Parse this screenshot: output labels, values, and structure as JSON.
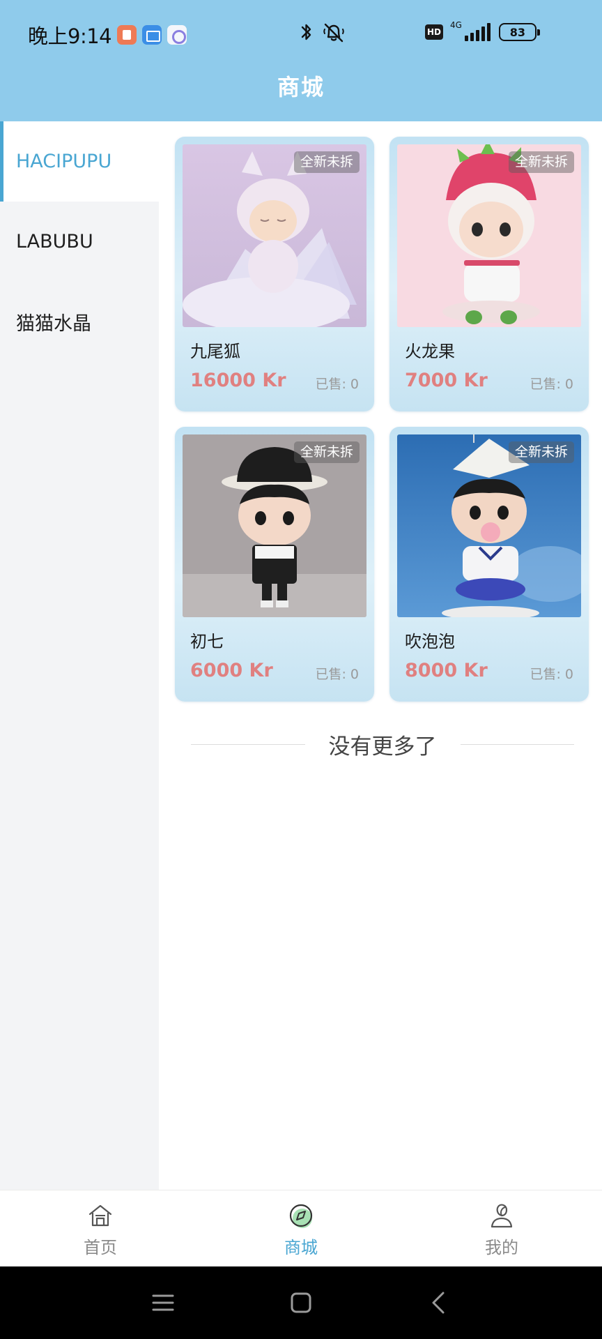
{
  "status_bar": {
    "time": "晚上9:14",
    "network": "4G",
    "hd": "HD",
    "battery": "83"
  },
  "header": {
    "title": "商城"
  },
  "sidebar": {
    "items": [
      {
        "label": "HACIPUPU",
        "active": true
      },
      {
        "label": "LABUBU",
        "active": false
      },
      {
        "label": "猫猫水晶",
        "active": false
      }
    ]
  },
  "products": [
    {
      "tag": "全新未拆",
      "name": "九尾狐",
      "price": "16000 Kr",
      "sold": "已售: 0"
    },
    {
      "tag": "全新未拆",
      "name": "火龙果",
      "price": "7000 Kr",
      "sold": "已售: 0"
    },
    {
      "tag": "全新未拆",
      "name": "初七",
      "price": "6000 Kr",
      "sold": "已售: 0"
    },
    {
      "tag": "全新未拆",
      "name": "吹泡泡",
      "price": "8000 Kr",
      "sold": "已售: 0"
    }
  ],
  "list_end": "没有更多了",
  "tabbar": {
    "items": [
      {
        "label": "首页",
        "icon": "home-icon",
        "active": false
      },
      {
        "label": "商城",
        "icon": "compass-icon",
        "active": true
      },
      {
        "label": "我的",
        "icon": "profile-icon",
        "active": false
      }
    ]
  },
  "colors": {
    "header_bg": "#8fcbeb",
    "accent": "#49a6d2",
    "price": "#e08080"
  }
}
